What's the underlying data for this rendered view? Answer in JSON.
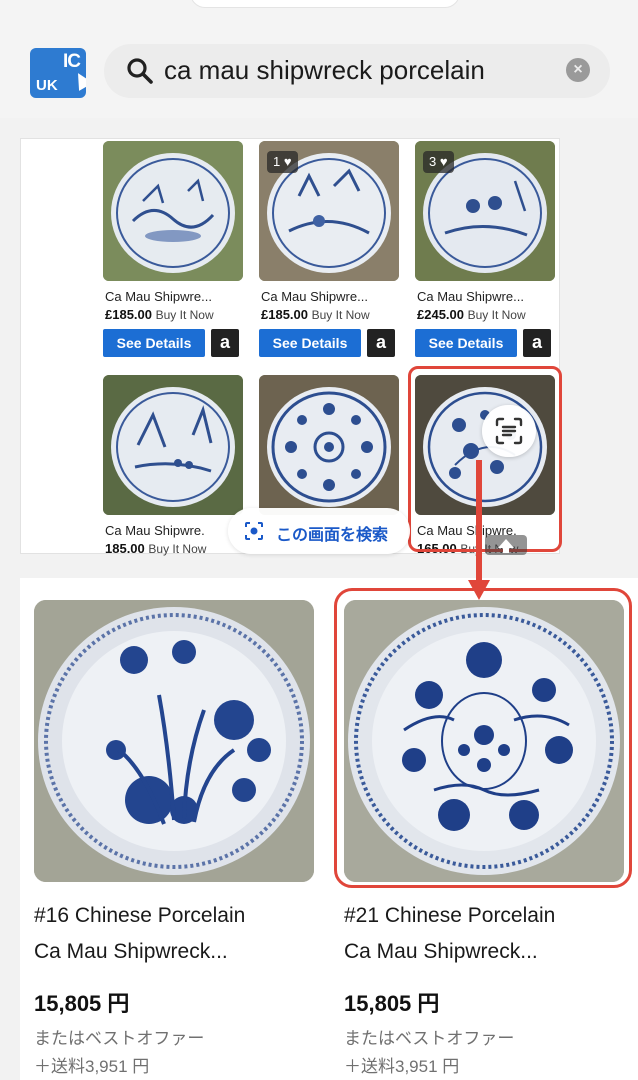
{
  "header": {
    "logo_top": "IC",
    "logo_bottom": "UK",
    "search_query": "ca mau shipwreck porcelain"
  },
  "amazon_widget": {
    "products": [
      {
        "title": "Ca Mau Shipwre...",
        "price": "£185.00",
        "buy_label": "Buy It Now",
        "button": "See Details",
        "amazon_glyph": "a",
        "likes": ""
      },
      {
        "title": "Ca Mau Shipwre...",
        "price": "£185.00",
        "buy_label": "Buy It Now",
        "button": "See Details",
        "amazon_glyph": "a",
        "likes": "1"
      },
      {
        "title": "Ca Mau Shipwre...",
        "price": "£245.00",
        "buy_label": "Buy It Now",
        "button": "See Details",
        "amazon_glyph": "a",
        "likes": "3"
      },
      {
        "title": "Ca Mau Shipwre.",
        "price": "185.00",
        "buy_label": "Buy It Now"
      },
      {
        "title": "",
        "price": "",
        "buy_label": ""
      },
      {
        "title": "Ca Mau Shipwre.",
        "price": "165.00",
        "buy_label": "Buy It Now"
      }
    ],
    "lens_chip_label": "この画面を検索"
  },
  "listings": [
    {
      "title_line1": "#16 Chinese Porcelain",
      "title_line2": "Ca Mau Shipwreck...",
      "price": "15,805 円",
      "offer": "またはベストオファー",
      "shipping": "＋送料3,951 円"
    },
    {
      "title_line1": "#21 Chinese Porcelain",
      "title_line2": "Ca Mau Shipwreck...",
      "price": "15,805 円",
      "offer": "またはベストオファー",
      "shipping": "＋送料3,951 円"
    }
  ],
  "colors": {
    "highlight": "#e0463a",
    "button_blue": "#1c6ed4",
    "logo_blue": "#2e7bd1",
    "lens_text": "#1a59c8"
  },
  "icons": [
    "search-icon",
    "clear-icon",
    "heart-icon",
    "amazon-icon",
    "lens-icon",
    "scan-text-icon",
    "scroll-up-icon"
  ]
}
